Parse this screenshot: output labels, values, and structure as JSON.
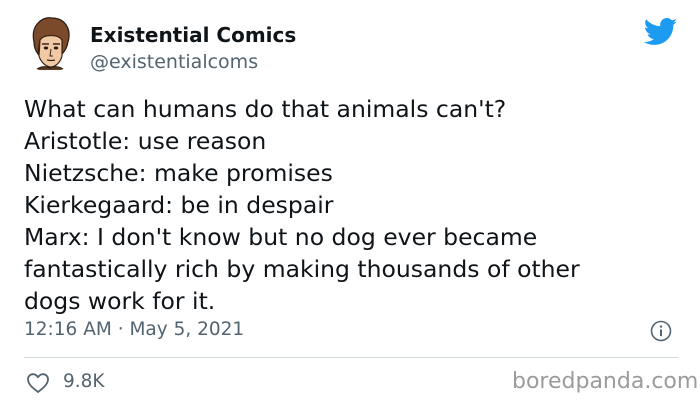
{
  "author": {
    "name": "Existential Comics",
    "handle": "@existentialcoms"
  },
  "tweet": {
    "lines": [
      "What can humans do that animals can't?",
      "Aristotle: use reason",
      "Nietzsche: make promises",
      "Kierkegaard: be in despair",
      "Marx: I don't know but no dog ever became",
      "fantastically rich by making thousands of other",
      "dogs work for it."
    ],
    "timestamp": "12:16 AM · May 5, 2021",
    "likes": "9.8K"
  },
  "watermark": "boredpanda.com",
  "icons": {
    "brand": "twitter-bird-icon",
    "info": "info-icon",
    "like": "heart-icon"
  },
  "colors": {
    "text_primary": "#0f1419",
    "text_secondary": "#536471",
    "twitter_blue": "#1d9bf0",
    "divider": "#cfd9de",
    "watermark": "#9b9b9b"
  }
}
